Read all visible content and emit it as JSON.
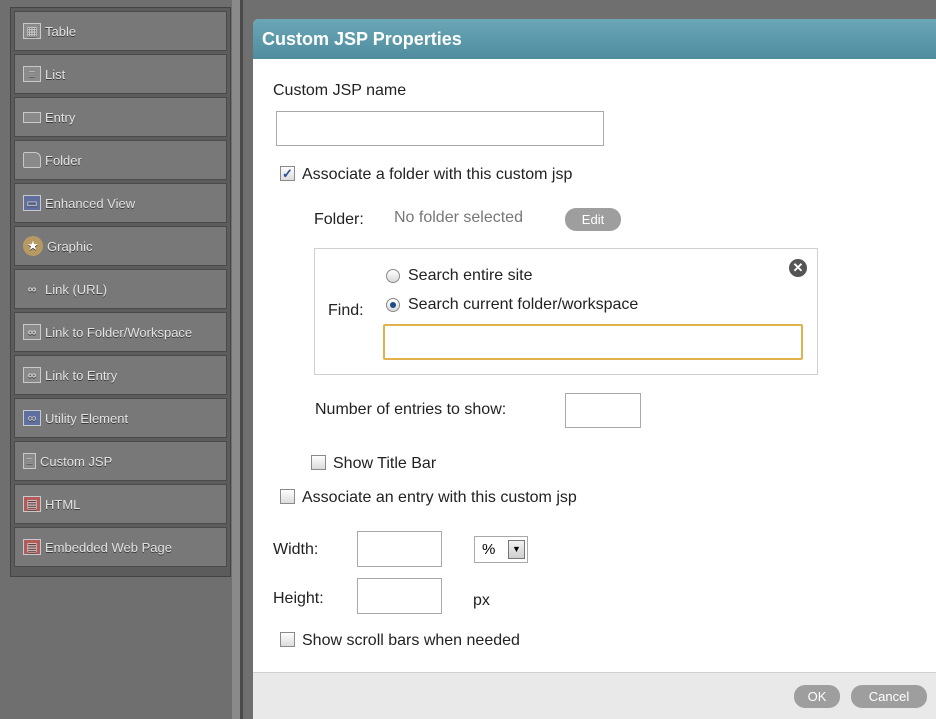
{
  "palette": {
    "items": [
      {
        "label": "Table",
        "icon": "table-icon"
      },
      {
        "label": "List",
        "icon": "list-icon"
      },
      {
        "label": "Entry",
        "icon": "entry-icon"
      },
      {
        "label": "Folder",
        "icon": "folder-icon"
      },
      {
        "label": "Enhanced View",
        "icon": "enhanced-view-icon"
      },
      {
        "label": "Graphic",
        "icon": "graphic-icon"
      },
      {
        "label": "Link (URL)",
        "icon": "link-icon"
      },
      {
        "label": "Link to Folder/Workspace",
        "icon": "link-folder-icon"
      },
      {
        "label": "Link to Entry",
        "icon": "link-entry-icon"
      },
      {
        "label": "Utility Element",
        "icon": "utility-element-icon"
      },
      {
        "label": "Custom JSP",
        "icon": "custom-jsp-icon"
      },
      {
        "label": "HTML",
        "icon": "html-icon"
      },
      {
        "label": "Embedded Web Page",
        "icon": "embedded-web-page-icon"
      }
    ]
  },
  "dialog": {
    "title": "Custom JSP Properties",
    "jsp_name_label": "Custom JSP name",
    "jsp_name_value": "",
    "assoc_folder_label": "Associate a folder with this custom jsp",
    "assoc_folder_checked": true,
    "folder_label": "Folder:",
    "folder_value": "No folder selected",
    "edit_button": "Edit",
    "find_label": "Find:",
    "search_site_label": "Search entire site",
    "search_current_label": "Search current folder/workspace",
    "find_value": "",
    "entries_label": "Number of entries to show:",
    "entries_value": "",
    "show_title_bar_label": "Show Title Bar",
    "assoc_entry_label": "Associate an entry with this custom jsp",
    "width_label": "Width:",
    "width_value": "",
    "width_unit": "%",
    "height_label": "Height:",
    "height_value": "",
    "height_unit": "px",
    "scroll_label": "Show scroll bars when needed",
    "ok_button": "OK",
    "cancel_button": "Cancel"
  },
  "colors": {
    "titlebar": "#5a98a9",
    "palette_bg": "#5c5c5c",
    "find_input_border": "#e0b24c"
  }
}
